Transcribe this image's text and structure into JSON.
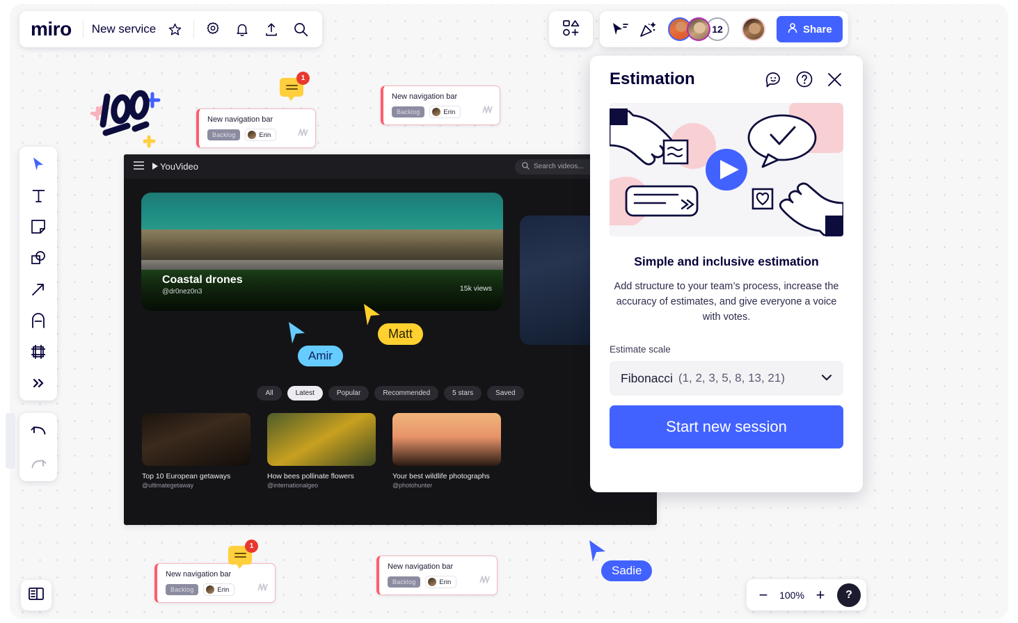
{
  "app": {
    "logo": "miro",
    "board_name": "New service",
    "toolbar_icons": [
      "star-icon",
      "gear-icon",
      "bell-icon",
      "upload-icon",
      "search-icon"
    ]
  },
  "topright": {
    "shapes_icon": "shapes-add-icon",
    "select_icon": "cursor-select-icon",
    "celebrate_icon": "confetti-icon",
    "collaborator_count": "12",
    "share_label": "Share",
    "share_icon": "person-icon",
    "share_color": "#4262ff"
  },
  "rail": {
    "items": [
      {
        "name": "select-tool",
        "icon": "cursor-icon"
      },
      {
        "name": "text-tool",
        "icon": "text-icon"
      },
      {
        "name": "sticky-note-tool",
        "icon": "sticky-note-icon"
      },
      {
        "name": "shapes-tool",
        "icon": "shapes-icon"
      },
      {
        "name": "arrow-tool",
        "icon": "arrow-icon"
      },
      {
        "name": "pen-tool",
        "icon": "pen-icon"
      },
      {
        "name": "frame-tool",
        "icon": "frame-icon"
      },
      {
        "name": "more-tools",
        "icon": "chevron-double-right-icon"
      }
    ],
    "undo_icon": "undo-icon",
    "redo_icon": "redo-icon",
    "panel_toggle_icon": "side-panel-icon"
  },
  "zoom": {
    "minus": "−",
    "value": "100%",
    "plus": "+",
    "help": "?"
  },
  "cards": [
    {
      "title": "New navigation bar",
      "status": "Backlog",
      "user": "Erin",
      "comments": "1"
    },
    {
      "title": "New navigation bar",
      "status": "Backlog",
      "user": "Erin",
      "comments": null
    },
    {
      "title": "New navigation bar",
      "status": "Backlog",
      "user": "Erin",
      "comments": "1"
    },
    {
      "title": "New navigation bar",
      "status": "Backlog",
      "user": "Erin",
      "comments": null
    }
  ],
  "sticker": {
    "label": "100"
  },
  "mock": {
    "menu_icon": "hamburger-icon",
    "brand": "YouVideo",
    "brand_icon": "play-triangle-icon",
    "search_placeholder": "Search videos...",
    "search_icon": "search-icon",
    "hero": {
      "title": "Coastal drones",
      "handle": "@dr0nez0n3",
      "views": "15k views"
    },
    "filters": [
      {
        "label": "All",
        "active": false
      },
      {
        "label": "Latest",
        "active": true
      },
      {
        "label": "Popular",
        "active": false
      },
      {
        "label": "Recommended",
        "active": false
      },
      {
        "label": "5 stars",
        "active": false
      },
      {
        "label": "Saved",
        "active": false
      }
    ],
    "videos": [
      {
        "title": "Top 10 European getaways",
        "handle": "@ultimategetaway"
      },
      {
        "title": "How bees pollinate flowers",
        "handle": "@internationalgeo"
      },
      {
        "title": "Your best wildlife photographs",
        "handle": "@photohunter"
      }
    ]
  },
  "cursors": [
    {
      "name": "Amir",
      "color": "#66ccff"
    },
    {
      "name": "Matt",
      "color": "#ffd02e"
    },
    {
      "name": "Sadie",
      "color": "#4262ff"
    }
  ],
  "panel": {
    "title": "Estimation",
    "icons": [
      "feedback-smiley-icon",
      "help-question-icon",
      "close-icon"
    ],
    "illustration": "estimation-hands-illustration",
    "heading": "Simple and inclusive estimation",
    "body": "Add structure to your team’s process, increase the accuracy of estimates, and give everyone a voice with votes.",
    "field_label": "Estimate scale",
    "scale_name": "Fibonacci",
    "scale_values": "(1, 2, 3, 5, 8, 13, 21)",
    "cta_label": "Start new session",
    "cta_color": "#4262ff"
  }
}
